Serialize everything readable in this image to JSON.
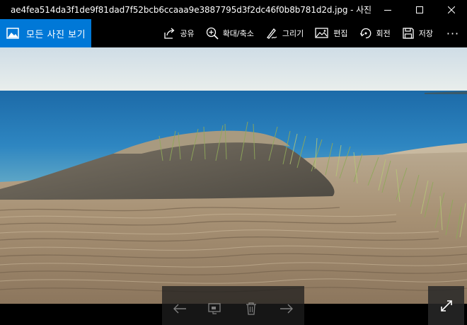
{
  "window": {
    "title": "ae4fea514da3f1de9f81dad7f52bcb6ccaaa9e3887795d3f2dc46f0b8b781d2d.jpg - 사진"
  },
  "toolbar": {
    "back_label": "모든 사진 보기",
    "items": [
      {
        "label": "공유",
        "icon": "share-icon"
      },
      {
        "label": "확대/축소",
        "icon": "zoom-icon"
      },
      {
        "label": "그리기",
        "icon": "draw-icon"
      },
      {
        "label": "편집",
        "icon": "edit-icon"
      },
      {
        "label": "회전",
        "icon": "rotate-icon"
      },
      {
        "label": "저장",
        "icon": "save-icon"
      }
    ],
    "more_label": "···"
  },
  "accent_color": "#0078d7"
}
